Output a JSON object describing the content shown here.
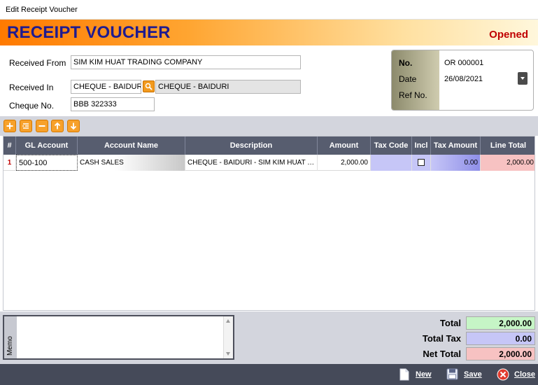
{
  "window": {
    "title": "Edit Receipt Voucher"
  },
  "banner": {
    "title": "RECEIPT VOUCHER",
    "status": "Opened"
  },
  "form": {
    "received_from_label": "Received From",
    "received_from_value": "SIM KIM HUAT TRADING COMPANY",
    "received_in_label": "Received In",
    "received_in_code": "CHEQUE - BAIDURI",
    "received_in_name": "CHEQUE - BAIDURI",
    "cheque_no_label": "Cheque No.",
    "cheque_no_value": "BBB 322333"
  },
  "doc": {
    "no_label": "No.",
    "no_value": "OR 000001",
    "date_label": "Date",
    "date_value": "26/08/2021",
    "ref_label": "Ref No.",
    "ref_value": ""
  },
  "toolbar": {
    "icons": [
      "add-row-icon",
      "insert-row-icon",
      "delete-row-icon",
      "move-up-icon",
      "move-down-icon"
    ]
  },
  "grid": {
    "columns": [
      "#",
      "GL Account",
      "Account Name",
      "Description",
      "Amount",
      "Tax Code",
      "Incl",
      "Tax Amount",
      "Line Total"
    ],
    "rows": [
      {
        "index": "1",
        "gl_account": "500-100",
        "account_name": "CASH SALES",
        "description": "CHEQUE - BAIDURI - SIM KIM HUAT TRADING COMPANY",
        "amount": "2,000.00",
        "tax_code": "",
        "incl": false,
        "tax_amount": "0.00",
        "line_total": "2,000.00"
      }
    ]
  },
  "memo": {
    "label": "Memo",
    "value": ""
  },
  "totals": {
    "total_label": "Total",
    "total_value": "2,000.00",
    "tax_label": "Total Tax",
    "tax_value": "0.00",
    "net_label": "Net Total",
    "net_value": "2,000.00"
  },
  "colors": {
    "total_bg": "#c6f5c6",
    "tax_bg": "#c6c6f7",
    "net_bg": "#f7c2c2",
    "banner_title": "#1f1b8f",
    "status": "#c00000"
  },
  "footer": {
    "new_label": "New",
    "save_label": "Save",
    "close_label": "Close"
  }
}
